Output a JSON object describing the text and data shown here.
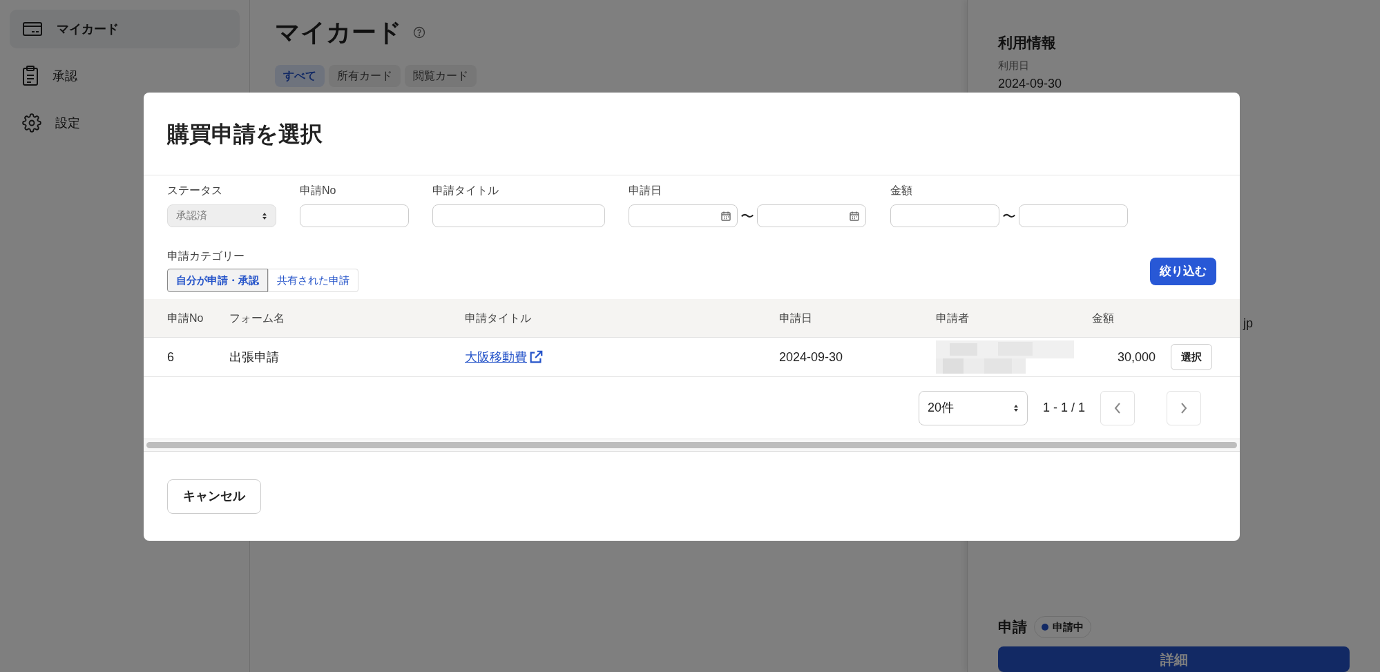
{
  "sidebar": {
    "items": [
      {
        "label": "マイカード",
        "selected": true
      },
      {
        "label": "承認",
        "selected": false
      },
      {
        "label": "設定",
        "selected": false
      }
    ]
  },
  "main": {
    "title": "マイカード",
    "tabs": [
      {
        "label": "すべて",
        "selected": true
      },
      {
        "label": "所有カード",
        "selected": false
      },
      {
        "label": "閲覧カード",
        "selected": false
      }
    ]
  },
  "detail_panel": {
    "section_title": "利用情報",
    "date_label": "利用日",
    "date_value": "2024-09-30",
    "email_fragment": "jp",
    "application_title": "申請",
    "status_badge": {
      "label": "申請中",
      "color": "#122964"
    },
    "detail_button": "詳細"
  },
  "dialog": {
    "title": "購買申請を選択",
    "filters": {
      "status": {
        "label": "ステータス",
        "value": "承認済"
      },
      "number": {
        "label": "申請No"
      },
      "title": {
        "label": "申請タイトル"
      },
      "date": {
        "label": "申請日",
        "separator": "〜"
      },
      "amount": {
        "label": "金額",
        "separator": "〜"
      },
      "category": {
        "label": "申請カテゴリー",
        "options": [
          {
            "label": "自分が申請・承認",
            "selected": true
          },
          {
            "label": "共有された申請",
            "selected": false
          }
        ]
      },
      "apply_button": "絞り込む"
    },
    "table": {
      "columns": [
        "申請No",
        "フォーム名",
        "申請タイトル",
        "申請日",
        "申請者",
        "金額"
      ],
      "rows": [
        {
          "number": "6",
          "form": "出張申請",
          "title": "大阪移動費",
          "date": "2024-09-30",
          "amount": "30,000",
          "action": "選択"
        }
      ]
    },
    "pagination": {
      "page_size": "20件",
      "range": "1 - 1 / 1"
    },
    "cancel_button": "キャンセル"
  }
}
